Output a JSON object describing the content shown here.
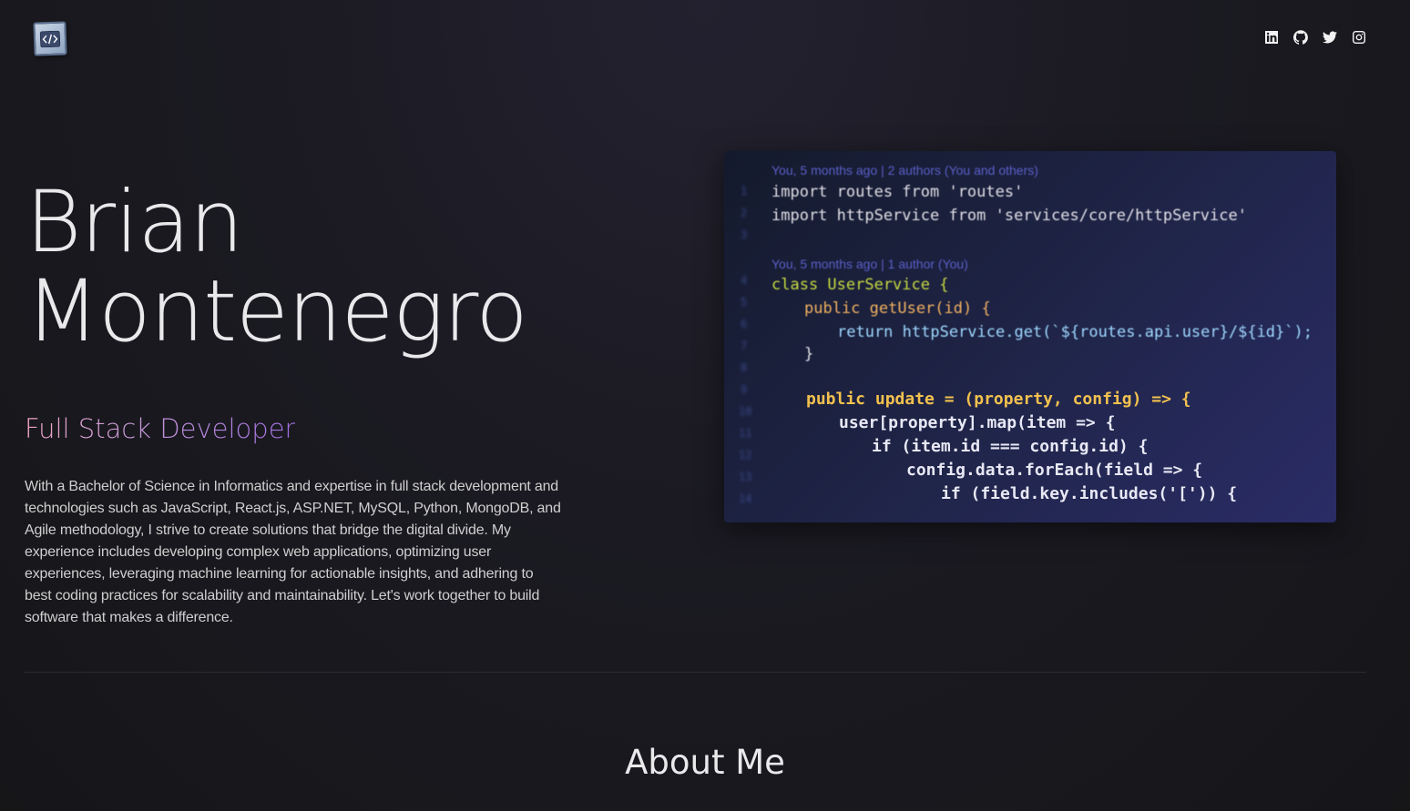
{
  "header": {
    "logo_icon": "code-brackets-icon",
    "social": [
      {
        "name": "linkedin",
        "icon": "linkedin-icon"
      },
      {
        "name": "github",
        "icon": "github-icon"
      },
      {
        "name": "twitter",
        "icon": "twitter-icon"
      },
      {
        "name": "instagram",
        "icon": "instagram-icon"
      }
    ]
  },
  "hero": {
    "first_name": "Brian",
    "last_name": "Montenegro",
    "role": "Full Stack Developer",
    "bio": "With a Bachelor of Science in Informatics and expertise in full stack development and technologies such as JavaScript, React.js, ASP.NET, MySQL, Python, MongoDB, and Agile methodology, I strive to create solutions that bridge the digital divide. My experience includes developing complex web applications, optimizing user experiences, leveraging machine learning for actionable insights, and adhering to best coding practices for scalability and maintainability. Let's work together to build software that makes a difference.",
    "image": {
      "blame1": "You, 5 months ago | 2 authors (You and others)",
      "blame2": "You, 5 months ago | 1 author (You)",
      "code_lines": [
        "import routes from 'routes'",
        "import httpService from 'services/core/httpService'",
        "class UserService {",
        "public getUser(id) {",
        "return httpService.get(`${routes.api.user}/${id}`);",
        "}",
        "public update = (property, config) => {",
        "user[property].map(item => {",
        "if (item.id === config.id) {",
        "config.data.forEach(field => {",
        "if (field.key.includes('[')) {"
      ]
    }
  },
  "about": {
    "title": "About Me"
  },
  "colors": {
    "background": "#19181f",
    "accent_start": "#f0a5c4",
    "accent_end": "#a070e0"
  }
}
